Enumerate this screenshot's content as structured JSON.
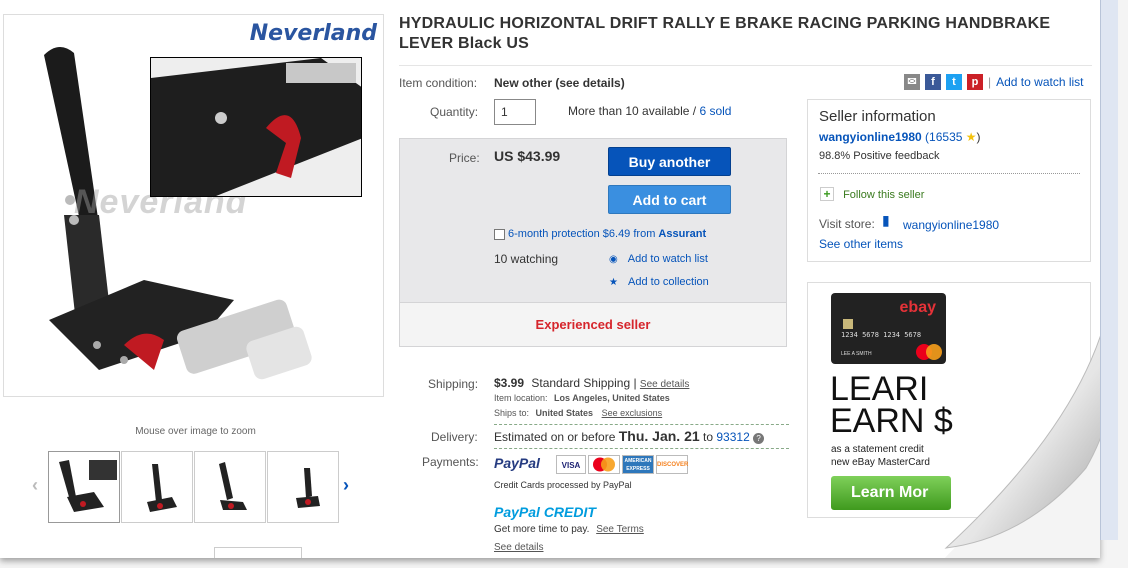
{
  "title": "HYDRAULIC HORIZONTAL DRIFT RALLY E BRAKE RACING PARKING HANDBRAKE LEVER Black US",
  "gallery": {
    "brand_logo": "Neverland",
    "watermark": "Neverland",
    "zoom_hint": "Mouse over image to zoom",
    "thumbnails": 4
  },
  "share": {
    "separator": "|",
    "watch_link": "Add to watch list"
  },
  "condition": {
    "label": "Item condition:",
    "value": "New other (see details)"
  },
  "quantity": {
    "label": "Quantity:",
    "value": "1",
    "availability": "More than 10 available /",
    "sold": "6 sold"
  },
  "price": {
    "label": "Price:",
    "value": "US $43.99"
  },
  "buttons": {
    "buy": "Buy another",
    "cart": "Add to cart"
  },
  "protection": {
    "text": "6-month protection $6.49 from",
    "brand": "Assurant"
  },
  "watching": "10 watching",
  "actions": {
    "watch": "Add to watch list",
    "collection": "Add to collection"
  },
  "experienced": "Experienced seller",
  "seller": {
    "heading": "Seller information",
    "name": "wangyionline1980",
    "score": "(16535",
    "score_close": ")",
    "feedback": "98.8% Positive feedback",
    "follow": "Follow this seller",
    "visit_label": "Visit store:",
    "store": "wangyionline1980",
    "other_items": "See other items"
  },
  "ad": {
    "card_brand": "ebay",
    "card_number": "1234 5678 1234 5678",
    "card_holder": "LEE A SMITH",
    "card_network": "MasterCard",
    "headline1": "LEARI",
    "headline2": "EARN",
    "headline2_suffix": "$",
    "line1": "as a statement credit",
    "line2": "new eBay MasterCard",
    "cta": "Learn Mor"
  },
  "shipping": {
    "label": "Shipping:",
    "cost": "$3.99",
    "method": "Standard Shipping |",
    "details": "See details",
    "location_label": "Item location:",
    "location": "Los Angeles, United States",
    "ships_label": "Ships to:",
    "ships": "United States",
    "exclusions": "See exclusions"
  },
  "delivery": {
    "label": "Delivery:",
    "prefix": "Estimated on or before",
    "date": "Thu. Jan. 21",
    "to": "to",
    "zip": "93312"
  },
  "payments": {
    "label": "Payments:",
    "paypal": "PayPal",
    "cards": [
      "VISA",
      "MasterCard",
      "AMERICAN EXPRESS",
      "DISCOVER"
    ],
    "note": "Credit Cards processed by PayPal",
    "credit": "PayPal CREDIT",
    "credit_note": "Get more time to pay.",
    "terms": "See Terms",
    "details": "See details"
  },
  "colors": {
    "link": "#0654ba",
    "buy": "#0654ba",
    "cart": "#3a8fe0",
    "experienced": "#d6252c"
  }
}
